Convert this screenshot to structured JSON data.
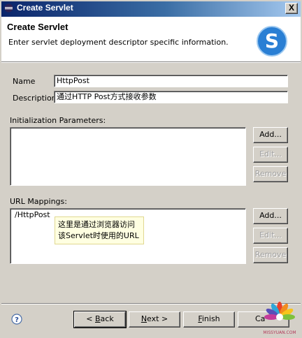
{
  "window": {
    "title": "Create Servlet",
    "close_label": "X"
  },
  "header": {
    "title": "Create Servlet",
    "description": "Enter servlet deployment descriptor specific information.",
    "logo_letter": "S"
  },
  "form": {
    "name_label": "Name",
    "name_value": "HttpPost",
    "description_label": "Description",
    "description_value": "通过HTTP Post方式接收参数"
  },
  "init_params": {
    "label": "Initialization Parameters:",
    "add": "Add...",
    "edit": "Edit...",
    "remove": "Remove"
  },
  "url_mappings": {
    "label": "URL Mappings:",
    "items": [
      "/HttpPost"
    ],
    "add": "Add...",
    "edit": "Edit...",
    "remove": "Remove",
    "note_line1": "这里是通过浏览器访问",
    "note_line2": "该Servlet时使用的URL"
  },
  "footer": {
    "back_prefix": "< ",
    "back_key": "B",
    "back_rest": "ack",
    "next_key": "N",
    "next_rest": "ext >",
    "finish_key": "F",
    "finish_rest": "inish",
    "cancel_label": "Ca",
    "watermark_text": "MISSYUAN.COM"
  },
  "colors": {
    "titlebar_start": "#0a246a",
    "titlebar_end": "#a6caf0",
    "logo_blue": "#2a7fd4",
    "tooltip_bg": "#ffffe1"
  }
}
